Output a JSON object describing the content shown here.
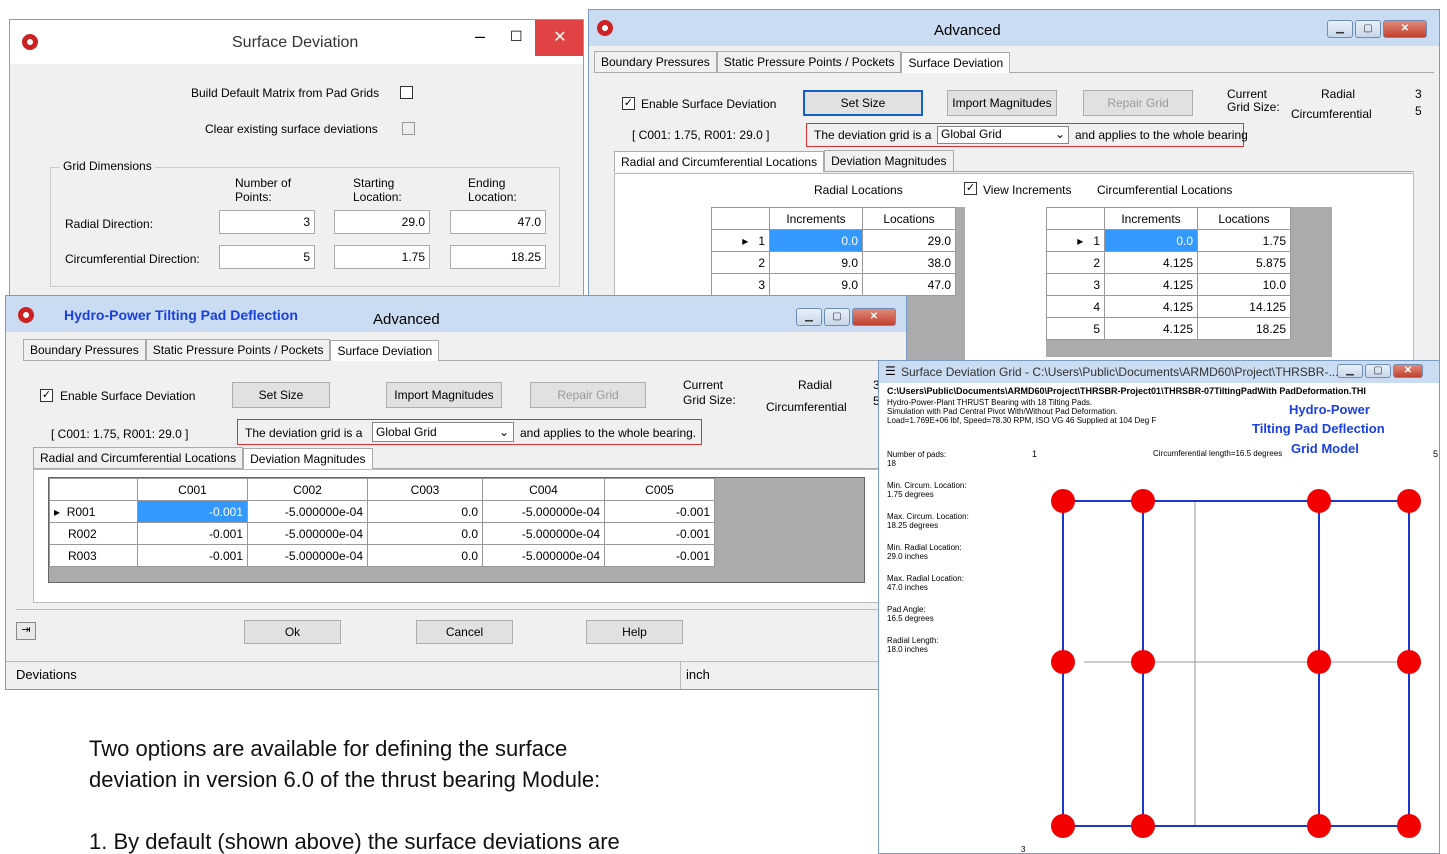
{
  "sd": {
    "title": "Surface Deviation",
    "build_label": "Build Default Matrix from Pad Grids",
    "clear_label": "Clear existing surface deviations",
    "group_label": "Grid Dimensions",
    "col_points": "Number of Points:",
    "col_start": "Starting Location:",
    "col_end": "Ending Location:",
    "radial_label": "Radial Direction:",
    "circ_label": "Circumferential Direction:",
    "radial_points": "3",
    "radial_start": "29.0",
    "radial_end": "47.0",
    "circ_points": "5",
    "circ_start": "1.75",
    "circ_end": "18.25"
  },
  "adv1": {
    "title": "Advanced",
    "tabs": [
      "Boundary Pressures",
      "Static Pressure Points / Pockets",
      "Surface Deviation"
    ],
    "enable_label": "Enable Surface Deviation",
    "set_size": "Set Size",
    "import": "Import Magnitudes",
    "repair": "Repair Grid",
    "current": "Current",
    "grid_size": "Grid Size:",
    "radial": "Radial",
    "radial_val": "3",
    "circ": "Circumferential",
    "circ_val": "5",
    "cell_ref": "[ C001: 1.75, R001: 29.0 ]",
    "dev_prefix": "The deviation grid is a",
    "dev_select": "Global Grid",
    "dev_suffix": "and applies to the whole bearing",
    "subtabs": [
      "Radial and Circumferential Locations",
      "Deviation Magnitudes"
    ],
    "radial_loc_title": "Radial Locations",
    "view_inc": "View Increments",
    "circ_loc_title": "Circumferential Locations",
    "h_inc": "Increments",
    "h_loc": "Locations",
    "radial_rows": [
      {
        "n": "1",
        "inc": "0.0",
        "loc": "29.0"
      },
      {
        "n": "2",
        "inc": "9.0",
        "loc": "38.0"
      },
      {
        "n": "3",
        "inc": "9.0",
        "loc": "47.0"
      }
    ],
    "circ_rows": [
      {
        "n": "1",
        "inc": "0.0",
        "loc": "1.75"
      },
      {
        "n": "2",
        "inc": "4.125",
        "loc": "5.875"
      },
      {
        "n": "3",
        "inc": "4.125",
        "loc": "10.0"
      },
      {
        "n": "4",
        "inc": "4.125",
        "loc": "14.125"
      },
      {
        "n": "5",
        "inc": "4.125",
        "loc": "18.25"
      }
    ]
  },
  "adv2": {
    "app": "Hydro-Power Tilting Pad Deflection",
    "title": "Advanced",
    "tabs": [
      "Boundary Pressures",
      "Static Pressure Points / Pockets",
      "Surface Deviation"
    ],
    "enable_label": "Enable Surface Deviation",
    "set_size": "Set Size",
    "import": "Import Magnitudes",
    "repair": "Repair Grid",
    "current": "Current",
    "grid_size": "Grid Size:",
    "radial": "Radial",
    "radial_val": "3",
    "circ": "Circumferential",
    "circ_val": "5",
    "cell_ref": "[ C001: 1.75, R001: 29.0 ]",
    "dev_prefix": "The deviation grid is a",
    "dev_select": "Global Grid",
    "dev_suffix": "and applies to the whole bearing.",
    "subtabs": [
      "Radial and Circumferential Locations",
      "Deviation Magnitudes"
    ],
    "cols": [
      "C001",
      "C002",
      "C003",
      "C004",
      "C005"
    ],
    "rows": [
      {
        "name": "R001",
        "vals": [
          "-0.001",
          "-5.000000e-04",
          "0.0",
          "-5.000000e-04",
          "-0.001"
        ]
      },
      {
        "name": "R002",
        "vals": [
          "-0.001",
          "-5.000000e-04",
          "0.0",
          "-5.000000e-04",
          "-0.001"
        ]
      },
      {
        "name": "R003",
        "vals": [
          "-0.001",
          "-5.000000e-04",
          "0.0",
          "-5.000000e-04",
          "-0.001"
        ]
      }
    ],
    "ok": "Ok",
    "cancel": "Cancel",
    "help": "Help",
    "status_left": "Deviations",
    "status_right": "inch"
  },
  "grid": {
    "title": "Surface Deviation Grid - C:\\Users\\Public\\Documents\\ARMD60\\Project\\THRSBR-...",
    "path": "C:\\Users\\Public\\Documents\\ARMD60\\Project\\THRSBR-Project01\\THRSBR-07TiltingPadWith PadDeformation.THI",
    "info1": "Hydro-Power-Plant THRUST Bearing with 18 Tilting Pads.",
    "info2": "Simulation with Pad Central Pivot With/Without Pad Deformation.",
    "info3": "Load=1.769E+06 lbf, Speed=78.30 RPM, ISO VG 46 Supplied at 104 Deg F",
    "brand1": "Hydro-Power",
    "brand2": "Tilting Pad Deflection",
    "brand3": "Grid Model",
    "one": "1",
    "five": "5",
    "three": "3",
    "circ_len": "Circumferential length=16.5 degrees",
    "stats": [
      {
        "label": "Number of pads:",
        "value": "18"
      },
      {
        "label": "Min. Circum. Location:",
        "value": "1.75 degrees"
      },
      {
        "label": "Max. Circum. Location:",
        "value": "18.25 degrees"
      },
      {
        "label": "Min. Radial Location:",
        "value": "29.0 inches"
      },
      {
        "label": "Max. Radial Location:",
        "value": "47.0 inches"
      },
      {
        "label": "Pad Angle:",
        "value": "16.5 degrees"
      },
      {
        "label": "Radial Length:",
        "value": "18.0 inches"
      }
    ]
  },
  "text": {
    "line1": "Two options are available for defining the surface",
    "line2": "deviation in version 6.0 of the thrust bearing Module:",
    "line3": "1. By default (shown above) the surface deviations are"
  }
}
